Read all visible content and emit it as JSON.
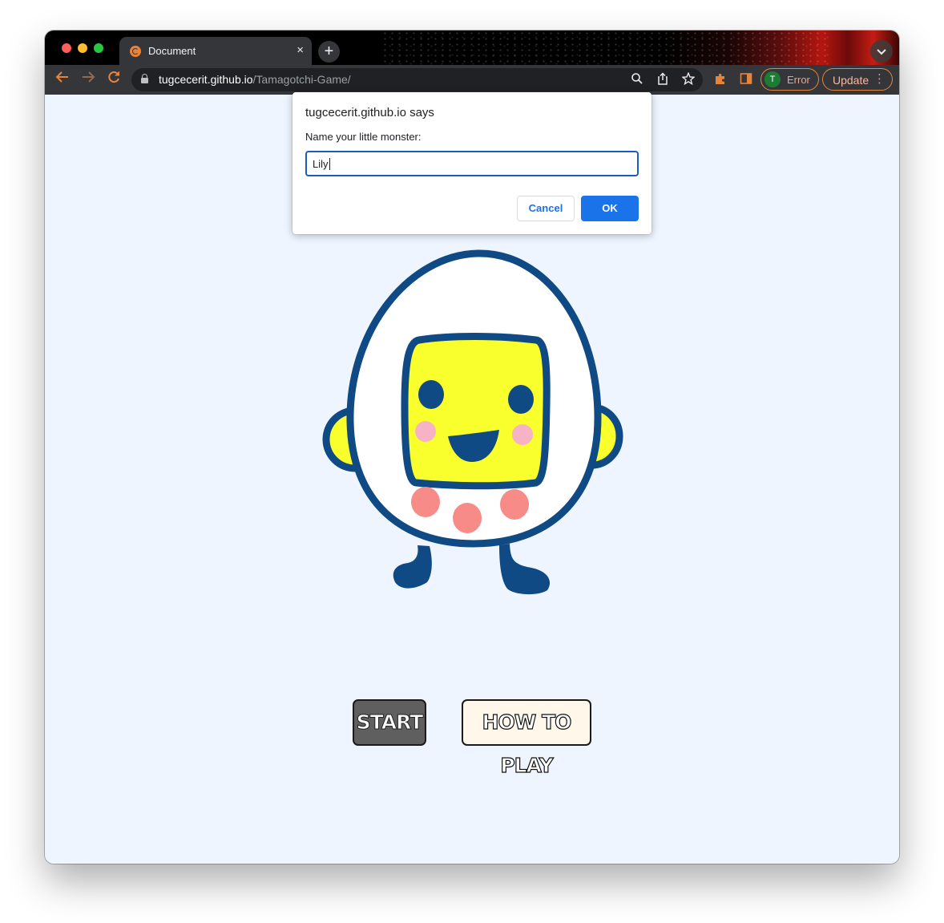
{
  "browser": {
    "tab_title": "Document",
    "tab_close": "×",
    "new_tab": "+",
    "tab_search": "⌄",
    "url_host": "tugcecerit.github.io",
    "url_path": "/Tamagotchi-Game/",
    "profile_initial": "T",
    "profile_status": "Error",
    "update_label": "Update",
    "menu_dots": "⋮",
    "accent_color": "#e8843a",
    "icons": [
      "back-arrow-icon",
      "forward-arrow-icon",
      "reload-icon",
      "lock-icon",
      "zoom-icon",
      "share-icon",
      "star-icon",
      "extensions-puzzle-icon",
      "side-panel-icon"
    ]
  },
  "dialog": {
    "title": "tugcecerit.github.io says",
    "message": "Name your little monster:",
    "input_value": "Lily",
    "cancel_label": "Cancel",
    "ok_label": "OK"
  },
  "game": {
    "start_label": "START",
    "howto_label": "HOW TO PLAY",
    "mascot_colors": {
      "outline": "#0f4a84",
      "face": "#f9ff2c",
      "cheeks": "#f7b3c6",
      "spots": "#f78b87"
    }
  }
}
